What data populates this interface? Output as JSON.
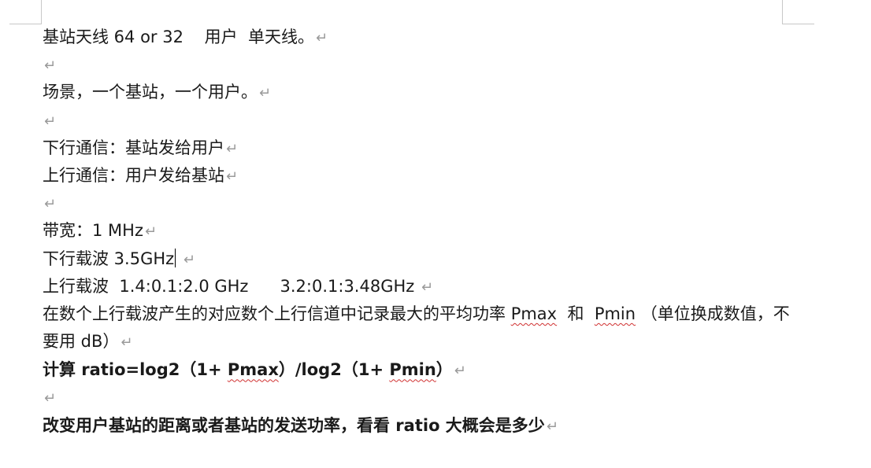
{
  "doc": {
    "lines": [
      {
        "id": "l1",
        "text": "基站天线 64 or 32    用户  单天线。"
      },
      {
        "id": "l2",
        "text": ""
      },
      {
        "id": "l3",
        "text": "场景，一个基站，一个用户。"
      },
      {
        "id": "l4",
        "text": ""
      },
      {
        "id": "l5",
        "text": "下行通信：基站发给用户"
      },
      {
        "id": "l6",
        "text": "上行通信：用户发给基站"
      },
      {
        "id": "l7",
        "text": ""
      },
      {
        "id": "l8",
        "text": "带宽：1 MHz"
      },
      {
        "id": "l9",
        "text": "下行载波 3.5GHz"
      },
      {
        "id": "l10",
        "text": "上行载波  1.4:0.1:2.0 GHz      3.2:0.1:3.48GHz "
      },
      {
        "id": "l11a",
        "text": "在数个上行载波产生的对应数个上行信道中记录最大的平均功率 "
      },
      {
        "id": "l11b",
        "text": "Pmax"
      },
      {
        "id": "l11c",
        "text": "  和  "
      },
      {
        "id": "l11d",
        "text": "Pmin"
      },
      {
        "id": "l11e",
        "text": "  （单位换成数值，不要用 dB）"
      },
      {
        "id": "l12a",
        "text": "计算 ratio=log2（1+ "
      },
      {
        "id": "l12b",
        "text": "Pmax"
      },
      {
        "id": "l12c",
        "text": "）/log2（1+ "
      },
      {
        "id": "l12d",
        "text": "Pmin"
      },
      {
        "id": "l12e",
        "text": "）"
      },
      {
        "id": "l13",
        "text": ""
      },
      {
        "id": "l14",
        "text": "改变用户基站的距离或者基站的发送功率，看看 ratio 大概会是多少"
      }
    ],
    "paragraph_mark": "↵"
  }
}
